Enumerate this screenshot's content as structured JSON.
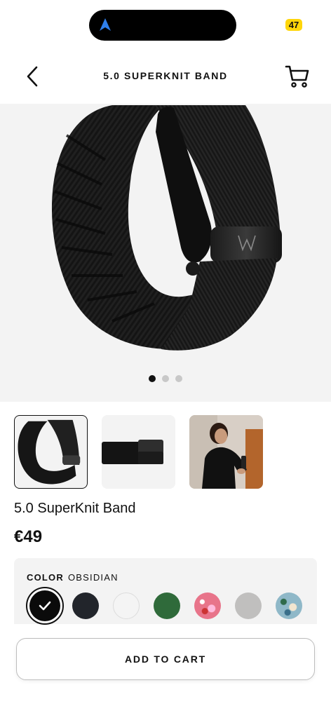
{
  "status_bar": {
    "battery": "47",
    "nav_icon": "location-arrow-icon"
  },
  "header": {
    "title": "5.0 SUPERKNIT BAND",
    "back_icon": "chevron-left-icon",
    "cart_icon": "cart-icon"
  },
  "carousel": {
    "slide_count": 3,
    "active_index": 0
  },
  "thumbnails": [
    {
      "name": "thumb-band-front",
      "selected": true
    },
    {
      "name": "thumb-band-side",
      "selected": false
    },
    {
      "name": "thumb-lifestyle-photo",
      "selected": false
    }
  ],
  "product": {
    "name": "5.0 SuperKnit Band",
    "price": "€49"
  },
  "color": {
    "label": "COLOR",
    "selected_name": "OBSIDIAN",
    "swatches": [
      {
        "name": "obsidian",
        "color": "#0b0b0b",
        "selected": true
      },
      {
        "name": "navy",
        "color": "#22252b",
        "selected": false
      },
      {
        "name": "white",
        "color": "#f4f4f4",
        "selected": false
      },
      {
        "name": "green",
        "color": "#2f6a3a",
        "selected": false
      },
      {
        "name": "floral-pink",
        "color": "#e8748a",
        "selected": false
      },
      {
        "name": "grey",
        "color": "#c0bfbe",
        "selected": false
      },
      {
        "name": "floral-blue",
        "color": "#8fb8c8",
        "selected": false
      }
    ]
  },
  "actions": {
    "add_to_cart": "ADD TO CART"
  }
}
